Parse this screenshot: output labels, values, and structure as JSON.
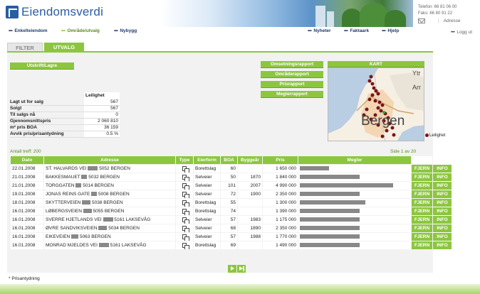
{
  "brand": {
    "name": "Eiendomsverdi"
  },
  "contact": {
    "phone": "Telefon: 66 81 06 00",
    "fax": "Faks: 66 80 91 22",
    "address": "Adresse"
  },
  "nav": {
    "items": [
      {
        "label": "Enkelteiendom",
        "active": false
      },
      {
        "label": "Område/utvalg",
        "active": true
      },
      {
        "label": "Nybygg",
        "active": false
      },
      {
        "label": "Nyheter",
        "active": false
      },
      {
        "label": "Faktaark",
        "active": false
      },
      {
        "label": "Hjelp",
        "active": false
      }
    ],
    "logout": "Logg ut"
  },
  "tabs": {
    "filter": "FILTER",
    "utvalg": "UTVALG"
  },
  "actions": {
    "print_save": "Utskrift/Lagre"
  },
  "reports": [
    "Omsetningsrapport",
    "Områderapport",
    "Prisrapport",
    "Meglerrapport"
  ],
  "map": {
    "title": "KART",
    "labels": {
      "yt": "Ytr",
      "arr": "Arr",
      "bergen": "Bergen"
    },
    "legend": "Leilighet"
  },
  "stats": {
    "header": "Leilighet",
    "rows": [
      {
        "label": "Lagt ut for salg",
        "value": "567"
      },
      {
        "label": "Solgt",
        "value": "567"
      },
      {
        "label": "Til salgs nå",
        "value": "0"
      },
      {
        "label": "Gjennomsnittspris",
        "value": "2 060 810"
      },
      {
        "label": "m² pris BOA",
        "value": "36 159"
      },
      {
        "label": "Avvik pris/prisantydning",
        "value": "0.5 %"
      }
    ]
  },
  "results": {
    "hits_label": "Antall treff: 200",
    "page_info": "Side 1 av 20",
    "columns": [
      "Dato",
      "Adresse",
      "Type",
      "Eierform",
      "BOA",
      "Byggeår",
      "Pris",
      "Megler"
    ],
    "rows": [
      {
        "date": "22.01.2008",
        "addr1": "ST. HALVARDS VEI",
        "addr2": "5052 BERGEN",
        "redact": 14,
        "ownership": "Borettslag",
        "boa": "60",
        "year": "",
        "price": "1 650 000",
        "broker": 0.27
      },
      {
        "date": "21.01.2008",
        "addr1": "BAKKESMAUET",
        "addr2": "5032 BERGEN",
        "redact": 8,
        "ownership": "Selveier",
        "boa": "50",
        "year": "1870",
        "price": "1 840 000",
        "broker": 0.56
      },
      {
        "date": "21.01.2008",
        "addr1": "TORGGATEN",
        "addr2": "5014 BERGEN",
        "redact": 8,
        "ownership": "Selveier",
        "boa": "101",
        "year": "2007",
        "price": "4 990 000",
        "broker": 0.87
      },
      {
        "date": "19.01.2008",
        "addr1": "JONAS REINS GATE",
        "addr2": "5008 BERGEN",
        "redact": 8,
        "ownership": "Selveier",
        "boa": "72",
        "year": "1900",
        "price": "2 350 000",
        "broker": 0.56
      },
      {
        "date": "18.01.2008",
        "addr1": "SKYTTERVEIEN",
        "addr2": "5038 BERGEN",
        "redact": 12,
        "ownership": "Borettslag",
        "boa": "55",
        "year": "",
        "price": "1 300 000",
        "broker": 0.61
      },
      {
        "date": "16.01.2008",
        "addr1": "LØBERGSVEIEN",
        "addr2": "5055 BERGEN",
        "redact": 12,
        "ownership": "Borettslag",
        "boa": "74",
        "year": "",
        "price": "1 390 000",
        "broker": 0.56
      },
      {
        "date": "16.01.2008",
        "addr1": "SVERRE HJETLANDS VEI",
        "addr2": "5161 LAKSEVÅG",
        "redact": 14,
        "ownership": "Selveier",
        "boa": "57",
        "year": "1983",
        "price": "1 175 000",
        "broker": 0.56
      },
      {
        "date": "16.01.2008",
        "addr1": "ØVRE SANDVIKSVEIEN",
        "addr2": "5034 BERGEN",
        "redact": 12,
        "ownership": "Selveier",
        "boa": "68",
        "year": "1890",
        "price": "2 350 000",
        "broker": 0.56
      },
      {
        "date": "16.01.2008",
        "addr1": "EIKEVEIEN",
        "addr2": "5063 BERGEN",
        "redact": 10,
        "ownership": "Selveier",
        "boa": "57",
        "year": "1988",
        "price": "1 770 000",
        "broker": 0.56
      },
      {
        "date": "16.01.2008",
        "addr1": "MONRAD MJELDES VEI",
        "addr2": "5161 LAKSEVÅG",
        "redact": 14,
        "ownership": "Borettslag",
        "boa": "69",
        "year": "",
        "price": "1 490 000",
        "broker": 0.56
      }
    ],
    "remove_label": "FJERN",
    "info_label": "INFO"
  },
  "footnote": "* Prisantydning"
}
